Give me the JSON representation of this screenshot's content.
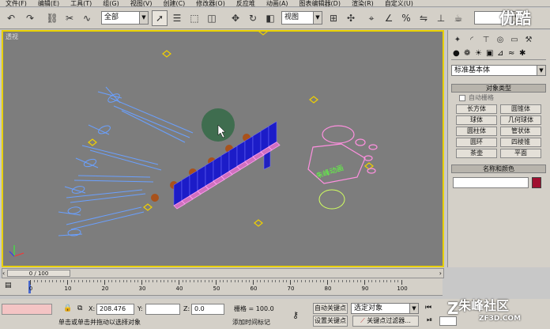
{
  "menu": [
    "文件(F)",
    "编辑(E)",
    "工具(T)",
    "组(G)",
    "视图(V)",
    "创建(C)",
    "修改器(O)",
    "反应堆",
    "动画(A)",
    "图表编辑器(D)",
    "渲染(R)",
    "自定义(U)"
  ],
  "toolbar": {
    "selection_filter": "全部",
    "ref_coord": "视图"
  },
  "viewport": {
    "label": "透视",
    "text_object": "朱峰动画"
  },
  "command_panel": {
    "category": "标准基本体",
    "object_type_title": "对象类型",
    "autogrid_label": "自动栅格",
    "buttons": [
      "长方体",
      "圆锥体",
      "球体",
      "几何球体",
      "圆柱体",
      "管状体",
      "圆环",
      "四棱锥",
      "茶壶",
      "平面"
    ],
    "name_color_title": "名称和颜色",
    "object_color": "#a01030"
  },
  "timeline": {
    "frame_display": "0 / 100",
    "ticks": [
      "0",
      "10",
      "20",
      "30",
      "40",
      "50",
      "60",
      "70",
      "80",
      "90",
      "100"
    ]
  },
  "status": {
    "x_label": "X:",
    "x_value": "208.476",
    "y_label": "Y:",
    "y_value": "",
    "z_label": "Z:",
    "z_value": "0.0",
    "grid_label": "栅格 = 100.0",
    "autokey_label": "自动关键点",
    "selected_object": "选定对象",
    "setkey_label": "设置关键点",
    "key_filters_label": "关键点过滤器...",
    "prompt": "单击或单击并拖动以选择对象",
    "add_time_tag": "添加时间标记"
  },
  "watermark": {
    "top_right": "优酷",
    "bottom_right": "朱峰社区",
    "bottom_url": "ZF3D.COM"
  }
}
